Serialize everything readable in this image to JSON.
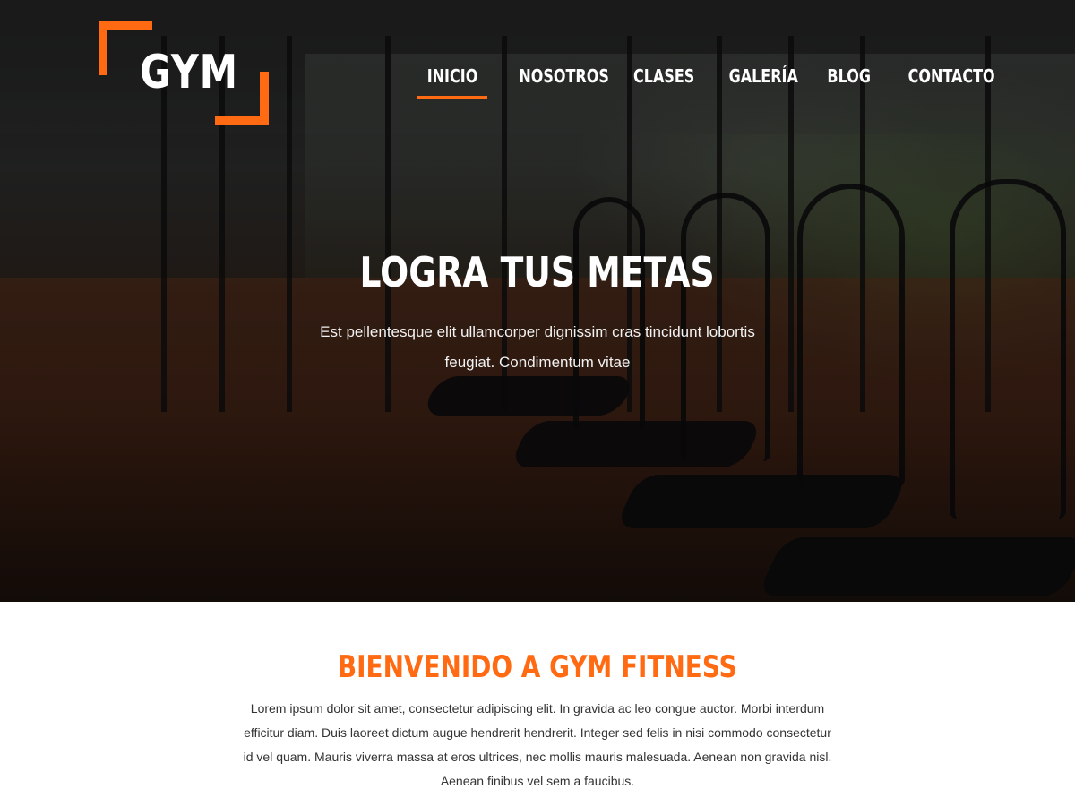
{
  "logo": {
    "text": "GYM"
  },
  "nav": {
    "items": [
      {
        "label": "INICIO",
        "active": true
      },
      {
        "label": "NOSOTROS",
        "active": false
      },
      {
        "label": "CLASES",
        "active": false
      },
      {
        "label": "GALERÍA",
        "active": false
      },
      {
        "label": "BLOG",
        "active": false
      },
      {
        "label": "CONTACTO",
        "active": false
      }
    ]
  },
  "hero": {
    "title": "LOGRA TUS METAS",
    "subtitle": "Est pellentesque elit ullamcorper dignissim cras tincidunt lobortis feugiat. Condimentum vitae"
  },
  "welcome": {
    "title": "BIENVENIDO A GYM FITNESS",
    "body": "Lorem ipsum dolor sit amet, consectetur adipiscing elit. In gravida ac leo congue auctor. Morbi interdum efficitur diam. Duis laoreet dictum augue hendrerit hendrerit. Integer sed felis in nisi commodo consectetur id vel quam. Mauris viverra massa at eros ultrices, nec mollis mauris malesuada. Aenean non gravida nisl. Aenean finibus vel sem a faucibus."
  },
  "colors": {
    "accent": "#ff6a13",
    "hero_text": "#ffffff",
    "body_text": "#333333"
  }
}
